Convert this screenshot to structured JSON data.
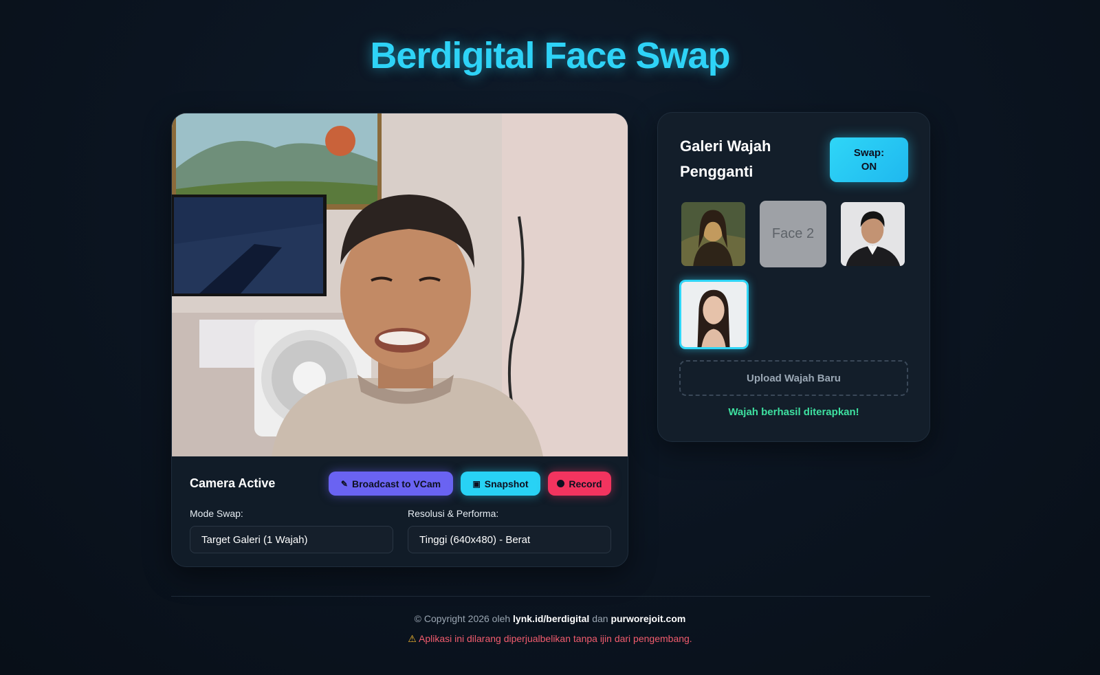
{
  "app": {
    "title": "Berdigital Face Swap"
  },
  "camera": {
    "status": "Camera Active",
    "buttons": {
      "broadcast": "Broadcast to VCam",
      "snapshot": "Snapshot",
      "record": "Record"
    },
    "mode_label": "Mode Swap:",
    "mode_value": "Target Galeri (1 Wajah)",
    "resolution_label": "Resolusi & Performa:",
    "resolution_value": "Tinggi (640x480) - Berat"
  },
  "gallery": {
    "title": "Galeri Wajah Pengganti",
    "swap_line1": "Swap:",
    "swap_line2": "ON",
    "faces": [
      {
        "label": "",
        "icon": "mona-lisa-portrait"
      },
      {
        "label": "Face 2",
        "icon": "placeholder"
      },
      {
        "label": "",
        "icon": "man-portrait"
      },
      {
        "label": "",
        "icon": "woman-portrait",
        "selected": true
      }
    ],
    "upload_label": "Upload Wajah Baru",
    "status_message": "Wajah berhasil diterapkan!"
  },
  "footer": {
    "copyright_prefix": "© Copyright 2026 oleh",
    "link1": "lynk.id/berdigital",
    "joiner": "dan",
    "link2": "purworejoit.com",
    "warning": "Aplikasi ini dilarang diperjualbelikan tanpa ijin dari pengembang."
  },
  "colors": {
    "accent": "#2ed3f7",
    "broadcast": "#6a63f2",
    "record": "#f3345f",
    "success": "#3ee0a0",
    "warning_text": "#f25c6e"
  }
}
